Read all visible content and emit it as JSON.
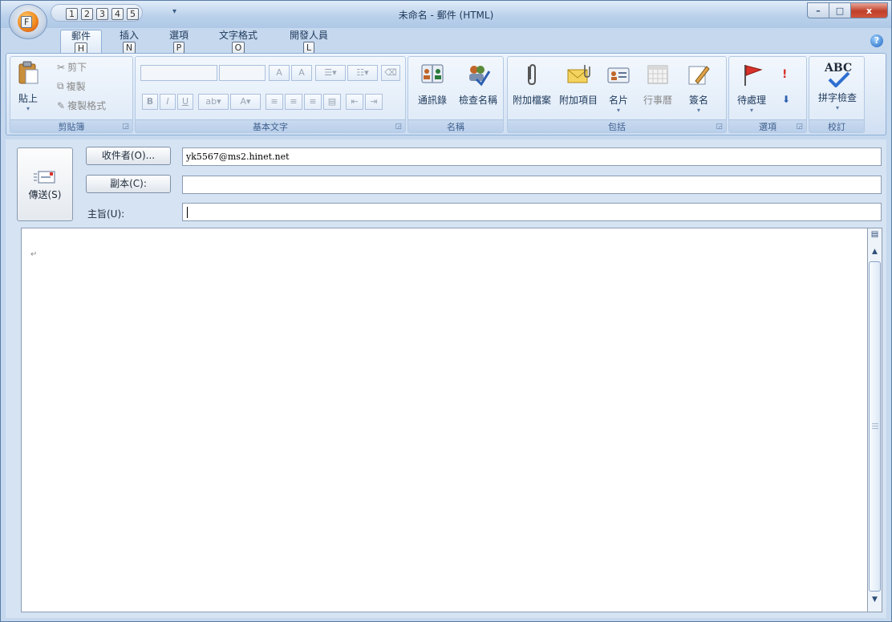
{
  "window": {
    "title": "未命名 - 郵件 (HTML)",
    "controls": {
      "minimize": "–",
      "maximize": "□",
      "close": "x"
    }
  },
  "office_button": {
    "keytip": "F"
  },
  "quick_access": {
    "keytips": [
      "1",
      "2",
      "3",
      "4",
      "5"
    ],
    "dropdown": "▾"
  },
  "tabs": [
    {
      "label": "郵件",
      "keytip": "H",
      "active": true
    },
    {
      "label": "插入",
      "keytip": "N"
    },
    {
      "label": "選項",
      "keytip": "P"
    },
    {
      "label": "文字格式",
      "keytip": "O"
    },
    {
      "label": "開發人員",
      "keytip": "L"
    }
  ],
  "help": "?",
  "ribbon": {
    "clipboard": {
      "title": "剪貼簿",
      "paste": "貼上",
      "cut": "剪下",
      "copy": "複製",
      "format_painter": "複製格式"
    },
    "basic_text": {
      "title": "基本文字",
      "bold": "B",
      "italic": "I",
      "underline": "U",
      "grow": "A",
      "shrink": "A"
    },
    "names": {
      "title": "名稱",
      "address_book": "通訊錄",
      "check_names": "檢查名稱"
    },
    "include": {
      "title": "包括",
      "attach_file": "附加檔案",
      "attach_item": "附加項目",
      "business_card": "名片",
      "calendar": "行事曆",
      "signature": "簽名"
    },
    "options": {
      "title": "選項",
      "follow_up": "待處理"
    },
    "proofing": {
      "title": "校訂",
      "spelling": "拼字檢查",
      "abc": "ABC"
    }
  },
  "compose": {
    "send": "傳送(S)",
    "to_button": "收件者(O)...",
    "cc_button": "副本(C):",
    "subject_label": "主旨(U):",
    "to_value": "yk5567@ms2.hinet.net",
    "cc_value": "",
    "subject_value": "",
    "paragraph_mark": "↵"
  },
  "colors": {
    "accent": "#1e395b",
    "ribbon": "#dbe7f5",
    "frame": "#c5d8ee"
  }
}
